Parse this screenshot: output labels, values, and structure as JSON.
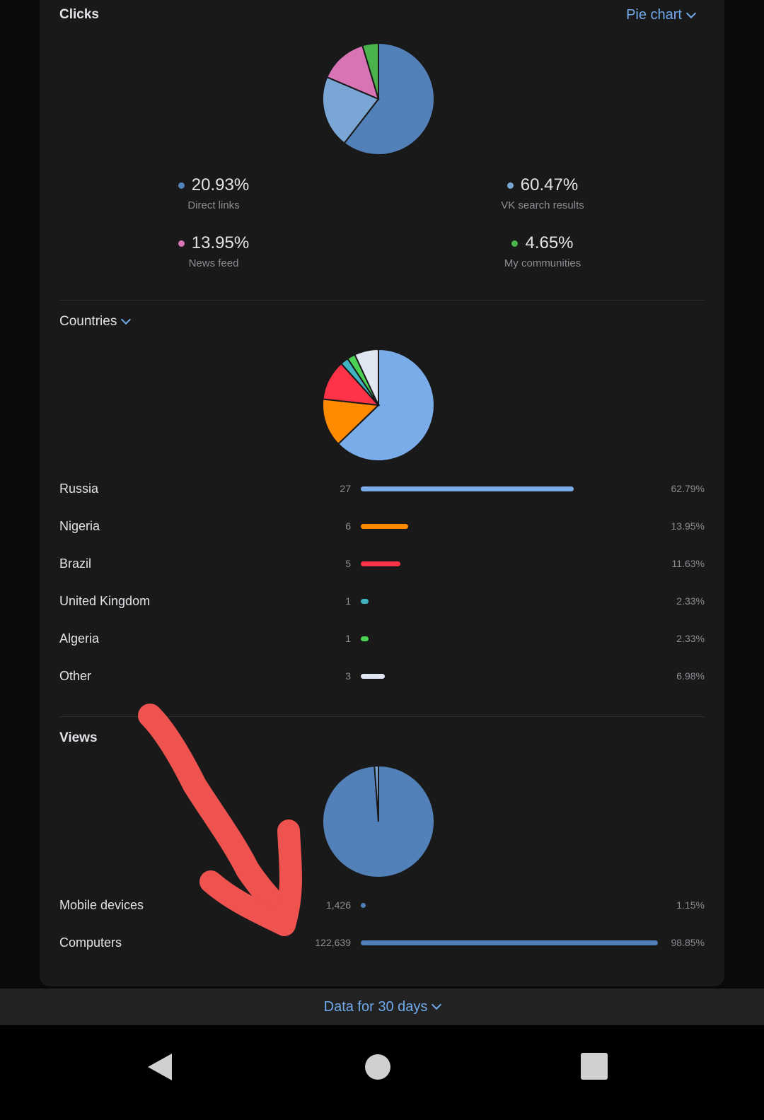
{
  "clicks": {
    "title": "Clicks",
    "view_selector": "Pie chart",
    "legend": [
      {
        "value": "20.93%",
        "label": "Direct links",
        "color": "#7aa6d6"
      },
      {
        "value": "60.47%",
        "label": "VK search results",
        "color": "#5181b8"
      },
      {
        "value": "13.95%",
        "label": "News feed",
        "color": "#d873b4"
      },
      {
        "value": "4.65%",
        "label": "My communities",
        "color": "#4bb34b"
      }
    ]
  },
  "countries": {
    "title": "Countries",
    "rows": [
      {
        "name": "Russia",
        "count": "27",
        "pct": "62.79%",
        "color": "#7aacea",
        "share": 0.6279
      },
      {
        "name": "Nigeria",
        "count": "6",
        "pct": "13.95%",
        "color": "#ff8a00",
        "share": 0.1395
      },
      {
        "name": "Brazil",
        "count": "5",
        "pct": "11.63%",
        "color": "#ff3347",
        "share": 0.1163
      },
      {
        "name": "United Kingdom",
        "count": "1",
        "pct": "2.33%",
        "color": "#3fb3c0",
        "share": 0.0233
      },
      {
        "name": "Algeria",
        "count": "1",
        "pct": "2.33%",
        "color": "#4bd154",
        "share": 0.0233
      },
      {
        "name": "Other",
        "count": "3",
        "pct": "6.98%",
        "color": "#e1e7f2",
        "share": 0.0698
      }
    ]
  },
  "views": {
    "title": "Views",
    "rows": [
      {
        "name": "Mobile devices",
        "count": "1,426",
        "pct": "1.15%",
        "color": "#5181b8",
        "share": 0.0115
      },
      {
        "name": "Computers",
        "count": "122,639",
        "pct": "98.85%",
        "color": "#5181b8",
        "share": 0.9885
      }
    ]
  },
  "footer": {
    "period_selector": "Data for 30 days"
  },
  "chart_data": [
    {
      "type": "pie",
      "title": "Clicks",
      "categories": [
        "VK search results",
        "Direct links",
        "News feed",
        "My communities"
      ],
      "values": [
        60.47,
        20.93,
        13.95,
        4.65
      ],
      "colors": [
        "#5181b8",
        "#7aa6d6",
        "#d873b4",
        "#4bb34b"
      ]
    },
    {
      "type": "pie",
      "title": "Countries",
      "categories": [
        "Russia",
        "Nigeria",
        "Brazil",
        "United Kingdom",
        "Algeria",
        "Other"
      ],
      "values": [
        62.79,
        13.95,
        11.63,
        2.33,
        2.33,
        6.98
      ],
      "colors": [
        "#7aacea",
        "#ff8a00",
        "#ff3347",
        "#3fb3c0",
        "#4bd154",
        "#e1e7f2"
      ]
    },
    {
      "type": "pie",
      "title": "Views",
      "categories": [
        "Computers",
        "Mobile devices"
      ],
      "values": [
        98.85,
        1.15
      ],
      "colors": [
        "#5181b8",
        "#7aa6d6"
      ]
    }
  ]
}
